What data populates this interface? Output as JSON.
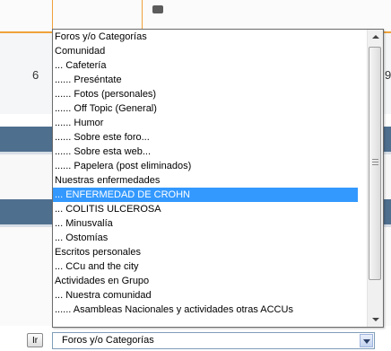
{
  "background": {
    "row_number_left": "6",
    "row_number_right_partial": "9"
  },
  "jump_form": {
    "go_button_label": "Ir",
    "selected_value": "Foros y/o Categorías"
  },
  "dropdown": {
    "options": [
      {
        "label": "Foros y/o Categorías",
        "selected": false
      },
      {
        "label": "Comunidad",
        "selected": false
      },
      {
        "label": "... Cafetería",
        "selected": false
      },
      {
        "label": "...... Preséntate",
        "selected": false
      },
      {
        "label": "...... Fotos (personales)",
        "selected": false
      },
      {
        "label": "...... Off Topic (General)",
        "selected": false
      },
      {
        "label": "...... Humor",
        "selected": false
      },
      {
        "label": "...... Sobre este foro...",
        "selected": false
      },
      {
        "label": "...... Sobre esta web...",
        "selected": false
      },
      {
        "label": "...... Papelera (post eliminados)",
        "selected": false
      },
      {
        "label": "Nuestras enfermedades",
        "selected": false
      },
      {
        "label": "... ENFERMEDAD DE CROHN",
        "selected": true
      },
      {
        "label": "... COLITIS ULCEROSA",
        "selected": false
      },
      {
        "label": "... Minusvalía",
        "selected": false
      },
      {
        "label": "... Ostomías",
        "selected": false
      },
      {
        "label": "Escritos personales",
        "selected": false
      },
      {
        "label": "... CCu and the city",
        "selected": false
      },
      {
        "label": "Actividades en Grupo",
        "selected": false
      },
      {
        "label": "... Nuestra comunidad",
        "selected": false
      },
      {
        "label": "...... Asambleas Nacionales y actividades otras ACCUs",
        "selected": false
      }
    ]
  },
  "colors": {
    "highlight": "#3399ff",
    "band": "#4f6f8f",
    "accent_line": "#f0a23a"
  }
}
